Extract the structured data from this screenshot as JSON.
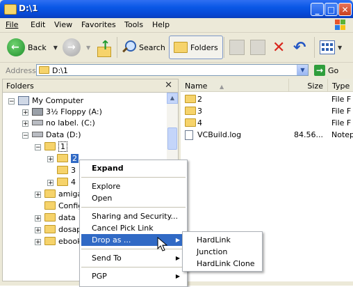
{
  "window": {
    "title": "D:\\1"
  },
  "menu": [
    "File",
    "Edit",
    "View",
    "Favorites",
    "Tools",
    "Help"
  ],
  "toolbar": {
    "back": "Back",
    "search": "Search",
    "folders": "Folders"
  },
  "address": {
    "label": "Address",
    "value": "D:\\1",
    "go": "Go"
  },
  "folders_pane": {
    "title": "Folders",
    "nodes": [
      {
        "label": "My Computer",
        "icon": "computer-icon"
      },
      {
        "label": "3½ Floppy (A:)",
        "icon": "floppy-icon"
      },
      {
        "label": "no label. (C:)",
        "icon": "drive-icon"
      },
      {
        "label": "Data (D:)",
        "icon": "drive-icon"
      },
      {
        "label": "1",
        "icon": "folder-icon"
      },
      {
        "label": "2",
        "icon": "folder-icon"
      },
      {
        "label": "3",
        "icon": "folder-icon"
      },
      {
        "label": "4",
        "icon": "folder-icon"
      },
      {
        "label": "amiga",
        "icon": "folder-icon"
      },
      {
        "label": "Config",
        "icon": "folder-icon"
      },
      {
        "label": "data",
        "icon": "folder-icon"
      },
      {
        "label": "dosap",
        "icon": "folder-icon"
      },
      {
        "label": "ebook",
        "icon": "folder-icon"
      }
    ]
  },
  "files_pane": {
    "columns": [
      "Name",
      "Size",
      "Type"
    ],
    "rows": [
      {
        "name": "2",
        "size": "",
        "type": "File F"
      },
      {
        "name": "3",
        "size": "",
        "type": "File F"
      },
      {
        "name": "4",
        "size": "",
        "type": "File F"
      },
      {
        "name": "VCBuild.log",
        "size": "84.56...",
        "type": "Notep"
      }
    ]
  },
  "context_menu": {
    "items": [
      "Expand",
      "Explore",
      "Open",
      "Sharing and Security...",
      "Cancel Pick Link",
      "Drop as ...",
      "Send To",
      "PGP"
    ]
  },
  "submenu": {
    "items": [
      "HardLink",
      "Junction",
      "HardLink Clone"
    ]
  },
  "colors": {
    "titlebar": "#0a58e6",
    "highlight": "#316ac5",
    "chrome": "#ece9d8"
  }
}
